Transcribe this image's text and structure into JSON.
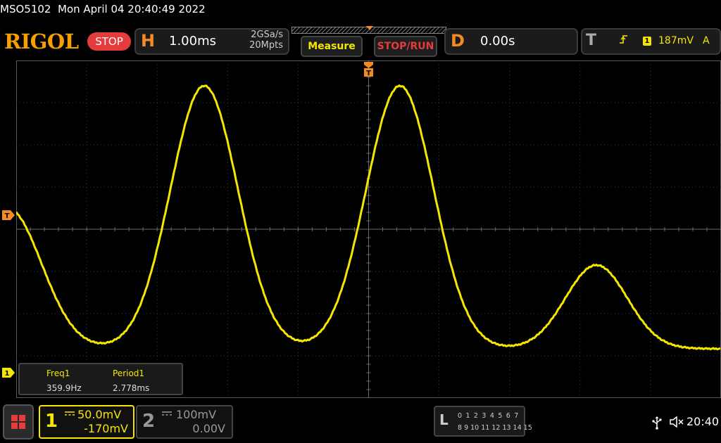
{
  "header": {
    "model": "MSO5102",
    "datetime": "Mon April 04 20:40:49 2022"
  },
  "brand": {
    "logo": "RIGOL",
    "run_state": "STOP"
  },
  "horizontal": {
    "tag": "H",
    "timebase": "1.00ms",
    "sample_rate": "2GSa/s",
    "memory_depth": "20Mpts"
  },
  "buttons": {
    "measure": "Measure",
    "stop_run": "STOP/RUN"
  },
  "delay": {
    "tag": "D",
    "value": "0.00s"
  },
  "trigger": {
    "tag": "T",
    "slope_icon": "rising-edge-icon",
    "source": "1",
    "level": "187mV",
    "mode": "A",
    "level_marker": "T",
    "position_marker": "T"
  },
  "measurements": {
    "freq_name": "Freq1",
    "freq_value": "359.9Hz",
    "period_name": "Period1",
    "period_value": "2.778ms"
  },
  "channels": {
    "ch1": {
      "number": "1",
      "coupling_icon": "dc-coupling-icon",
      "scale": "50.0mV",
      "offset": "-170mV",
      "marker": "1",
      "color": "#f5e600"
    },
    "ch2": {
      "number": "2",
      "coupling_icon": "dc-coupling-icon",
      "scale": "100mV",
      "offset": "0.00V",
      "color": "#999999"
    }
  },
  "logic": {
    "tag": "L",
    "row1": "0 1 2 3  4 5 6 7",
    "row2": "8 9 10 11 12 13 14 15"
  },
  "status": {
    "usb_icon": "usb-icon",
    "speaker_icon": "speaker-muted-icon",
    "clock": "20:40"
  },
  "colors": {
    "accent_orange": "#f28b24",
    "trace_yellow": "#f5e600",
    "stop_red": "#e63b3b"
  }
}
